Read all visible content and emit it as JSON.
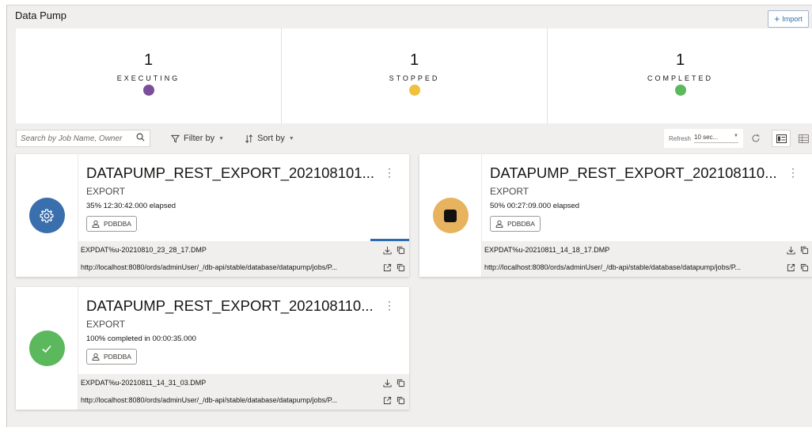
{
  "header": {
    "title": "Data Pump",
    "import_label": "Import"
  },
  "stats": [
    {
      "count": "1",
      "label": "EXECUTING",
      "color": "#7a4f99"
    },
    {
      "count": "1",
      "label": "STOPPED",
      "color": "#f0c13e"
    },
    {
      "count": "1",
      "label": "COMPLETED",
      "color": "#5cb85c"
    }
  ],
  "toolbar": {
    "search_placeholder": "Search by Job Name, Owner",
    "filter_label": "Filter by",
    "sort_label": "Sort by",
    "refresh_label": "Refresh",
    "refresh_value": "10 sec..."
  },
  "jobs": [
    {
      "title": "DATAPUMP_REST_EXPORT_202108101...",
      "type": "EXPORT",
      "progress": "35% 12:30:42.000 elapsed",
      "owner": "PDBDBA",
      "file": "EXPDAT%u-20210810_23_28_17.DMP",
      "url": "http://localhost:8080/ords/adminUser/_/db-api/stable/database/datapump/jobs/P...",
      "status": "executing",
      "icon": "gear-icon",
      "color": "#3a6fae"
    },
    {
      "title": "DATAPUMP_REST_EXPORT_202108110...",
      "type": "EXPORT",
      "progress": "50% 00:27:09.000 elapsed",
      "owner": "PDBDBA",
      "file": "EXPDAT%u-20210811_14_18_17.DMP",
      "url": "http://localhost:8080/ords/adminUser/_/db-api/stable/database/datapump/jobs/P...",
      "status": "stopped",
      "icon": "stop-icon",
      "color": "#e8b35f"
    },
    {
      "title": "DATAPUMP_REST_EXPORT_202108110...",
      "type": "EXPORT",
      "progress": "100% completed in 00:00:35.000",
      "owner": "PDBDBA",
      "file": "EXPDAT%u-20210811_14_31_03.DMP",
      "url": "http://localhost:8080/ords/adminUser/_/db-api/stable/database/datapump/jobs/P...",
      "status": "completed",
      "icon": "checkmark-icon",
      "color": "#5cb85c"
    }
  ]
}
